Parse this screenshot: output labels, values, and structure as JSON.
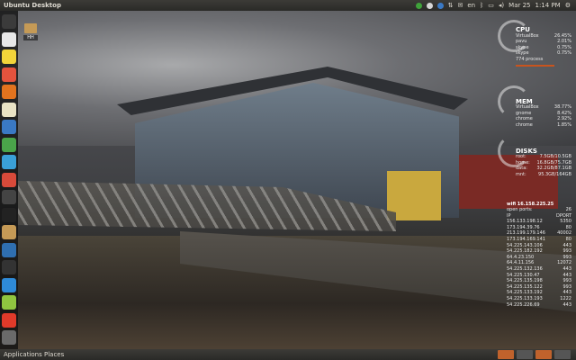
{
  "topbar": {
    "title": "Ubuntu Desktop",
    "indicators": [
      "en"
    ],
    "date": "Mar 25",
    "time": "1:14 PM"
  },
  "desktop_icons": [
    {
      "label": "HH"
    }
  ],
  "launcher": {
    "items": [
      {
        "icon": "dash-home-icon",
        "color": "#3b3b3b"
      },
      {
        "icon": "text-editor-icon",
        "color": "#e8e8e8"
      },
      {
        "icon": "pencil-icon",
        "color": "#f2d43a"
      },
      {
        "icon": "chrome-icon",
        "color": "#e5533d"
      },
      {
        "icon": "firefox-icon",
        "color": "#e2731e"
      },
      {
        "icon": "mail-icon",
        "color": "#e9e3c5"
      },
      {
        "icon": "document-icon",
        "color": "#3a79c4"
      },
      {
        "icon": "spreadsheet-icon",
        "color": "#4aa44a"
      },
      {
        "icon": "cloud-icon",
        "color": "#3aa0d8"
      },
      {
        "icon": "puzzle-icon",
        "color": "#d84a3a"
      },
      {
        "icon": "disc-icon",
        "color": "#444444"
      },
      {
        "icon": "terminal-icon",
        "color": "#222222"
      },
      {
        "icon": "folder-icon",
        "color": "#c59a56"
      },
      {
        "icon": "monitor-icon",
        "color": "#2f6fb0"
      },
      {
        "icon": "system-monitor-icon",
        "color": "#333333"
      },
      {
        "icon": "graph-icon",
        "color": "#2e8ad8"
      },
      {
        "icon": "android-icon",
        "color": "#8fc440"
      },
      {
        "icon": "app-grid-icon",
        "color": "#e03a2a"
      },
      {
        "icon": "trash-icon",
        "color": "#6a6a6a"
      }
    ]
  },
  "conky": {
    "cpu": {
      "title": "CPU",
      "rows": [
        {
          "name": "VirtualBox",
          "value": "26.45%"
        },
        {
          "name": "pavu",
          "value": "2.01%"
        },
        {
          "name": "skype",
          "value": "0.75%"
        },
        {
          "name": "skype",
          "value": "0.75%"
        }
      ],
      "footer": "774 process"
    },
    "mem": {
      "title": "MEM",
      "rows": [
        {
          "name": "VirtualBox",
          "value": "38.77%"
        },
        {
          "name": "gnome",
          "value": "8.42%"
        },
        {
          "name": "chrome",
          "value": "2.92%"
        },
        {
          "name": "chrome",
          "value": "1.85%"
        }
      ]
    },
    "disks": {
      "title": "DISKS",
      "rows": [
        {
          "name": "root:",
          "value": "7.5GB/10.5GB"
        },
        {
          "name": "home:",
          "value": "16.8GB/75.7GB"
        },
        {
          "name": "data:",
          "value": "32.2GB/87.1GB"
        },
        {
          "name": "mnt:",
          "value": "95.3GB/164GB"
        }
      ]
    },
    "network": {
      "ip_label": "wifi 16.158.225.25",
      "open_ports_label": "open ports:",
      "open_ports_value": "26",
      "col_ip": "IP",
      "col_port": "DPORT",
      "rows": [
        {
          "ip": "156.133.198.12",
          "port": "5350"
        },
        {
          "ip": "173.194.39.76",
          "port": "80"
        },
        {
          "ip": "213.199.179.146",
          "port": "40002"
        },
        {
          "ip": "173.194.169.141",
          "port": "80"
        },
        {
          "ip": "54.225.143.106",
          "port": "443"
        },
        {
          "ip": "54.225.182.192",
          "port": "993"
        },
        {
          "ip": "64.4.23.150",
          "port": "993"
        },
        {
          "ip": "64.4.11.156",
          "port": "12072"
        },
        {
          "ip": "54.225.132.136",
          "port": "443"
        },
        {
          "ip": "54.225.130.47",
          "port": "443"
        },
        {
          "ip": "54.225.135.198",
          "port": "993"
        },
        {
          "ip": "54.225.135.122",
          "port": "993"
        },
        {
          "ip": "54.225.133.192",
          "port": "443"
        },
        {
          "ip": "54.225.133.193",
          "port": "1222"
        },
        {
          "ip": "54.225.226.69",
          "port": "443"
        }
      ]
    }
  },
  "bottombar": {
    "menus": "Applications Places"
  }
}
